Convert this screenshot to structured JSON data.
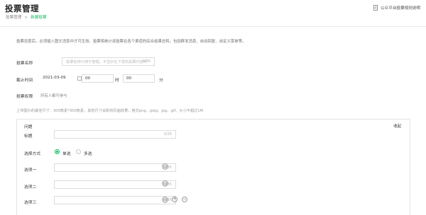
{
  "header": {
    "title": "投票管理",
    "breadcrumb_root": "投票管理",
    "breadcrumb_sep": ">",
    "breadcrumb_current": "新建投票",
    "help_link": "公众平台投票规则说明"
  },
  "notice": "投票设置后，必须插入图文消息中才可生效。投票将统计该投票在各个渠道的综合结果总和，包括群发消息、自动回复、自定义菜单等。",
  "form": {
    "name_label": "投票名称",
    "name_placeholder": "投票名称只用于管理，不显示在下发的投票内容中",
    "name_counter": "0/35",
    "deadline_label": "截止时间",
    "deadline_date": "2021-03-09",
    "deadline_hour": "00",
    "hour_unit": "时",
    "deadline_minute": "00",
    "minute_unit": "分",
    "permission_label": "投票权限",
    "permission_value": "所有人都可参与"
  },
  "upload_hint": "上传图片的最佳尺寸：300像素*300像素，其他尺寸会影响页面效果，格式png、jpeg、jpg、gif。大小不超过1M",
  "question": {
    "header_label": "问题",
    "collapse_label": "收起",
    "title_label": "标题",
    "title_counter": "0/35",
    "select_label": "选择方式",
    "single_label": "单选",
    "multi_label": "多选",
    "options": [
      {
        "label": "选项一",
        "counter": "0/35"
      },
      {
        "label": "选项二",
        "counter": "0/35"
      },
      {
        "label": "选项三",
        "counter": "0/35"
      }
    ]
  },
  "icons": {
    "help": "document-icon",
    "calendar": "calendar-icon",
    "image": "image-upload-icon",
    "add": "plus-circle-icon",
    "remove": "minus-circle-icon"
  },
  "colors": {
    "accent": "#07c160"
  }
}
